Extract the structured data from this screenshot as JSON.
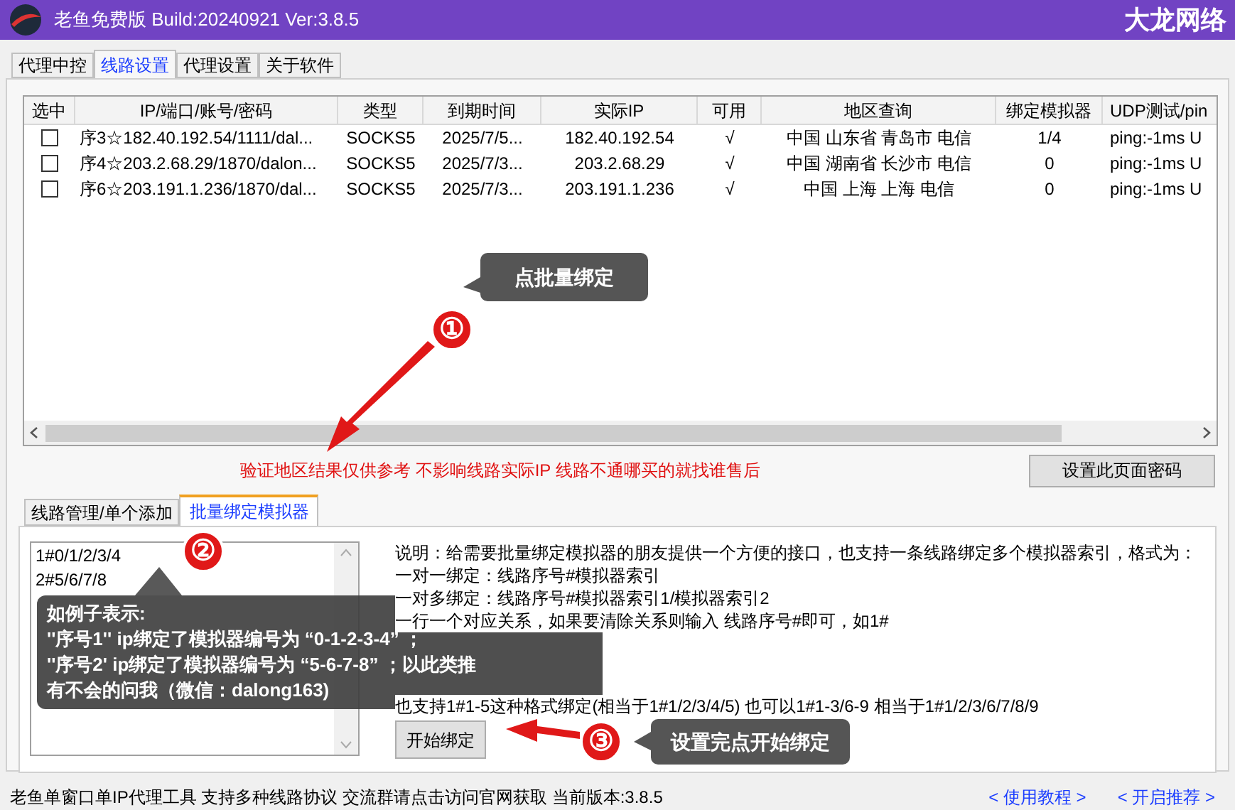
{
  "window": {
    "title": "老鱼免费版 Build:20240921 Ver:3.8.5",
    "brand": "大龙网络"
  },
  "tabs": [
    {
      "label": "代理中控",
      "selected": false
    },
    {
      "label": "线路设置",
      "selected": true
    },
    {
      "label": "代理设置",
      "selected": false
    },
    {
      "label": "关于软件",
      "selected": false
    }
  ],
  "table": {
    "check_column": "选中",
    "columns": [
      "IP/端口/账号/密码",
      "类型",
      "到期时间",
      "实际IP",
      "可用",
      "地区查询",
      "绑定模拟器",
      "UDP测试/pin"
    ],
    "rows": [
      {
        "checked": false,
        "cells": [
          "序3☆182.40.192.54/1111/dal...",
          "SOCKS5",
          "2025/7/5...",
          "182.40.192.54",
          "√",
          "中国 山东省 青岛市  电信",
          "1/4",
          "ping:-1ms  U"
        ]
      },
      {
        "checked": false,
        "cells": [
          "序4☆203.2.68.29/1870/dalon...",
          "SOCKS5",
          "2025/7/3...",
          "203.2.68.29",
          "√",
          "中国 湖南省 长沙市  电信",
          "0",
          "ping:-1ms  U"
        ]
      },
      {
        "checked": false,
        "cells": [
          "序6☆203.191.1.236/1870/dal...",
          "SOCKS5",
          "2025/7/3...",
          "203.191.1.236",
          "√",
          "中国 上海 上海  电信",
          "0",
          "ping:-1ms  U"
        ]
      }
    ]
  },
  "notice": "验证地区结果仅供参考 不影响线路实际IP 线路不通哪买的就找谁售后",
  "password_button": "设置此页面密码",
  "sub_tabs": [
    {
      "label": "线路管理/单个添加",
      "selected": false
    },
    {
      "label": "批量绑定模拟器",
      "selected": true
    }
  ],
  "bind_input": {
    "value": "1#0/1/2/3/4\n2#5/6/7/8"
  },
  "instructions": [
    "说明：给需要批量绑定模拟器的朋友提供一个方便的接口，也支持一条线路绑定多个模拟器索引，格式为：",
    "一对一绑定：线路序号#模拟器索引",
    "一对多绑定：线路序号#模拟器索引1/模拟器索引2",
    "一行一个对应关系，如果要清除关系则输入 线路序号#即可，如1#",
    "也支持1#1-5这种格式绑定(相当于1#1/2/3/4/5) 也可以1#1-3/6-9 相当于1#1/2/3/6/7/8/9"
  ],
  "start_button": "开始绑定",
  "status_bar": {
    "text": "老鱼单窗口单IP代理工具 支持多种线路协议 交流群请点击访问官网获取  当前版本:3.8.5",
    "links": [
      "< 使用教程 >",
      "< 开启推荐 >"
    ]
  },
  "annotations": [
    {
      "kind": "callout",
      "text": "点批量绑定"
    },
    {
      "kind": "step",
      "text": "①"
    },
    {
      "kind": "step",
      "text": "②"
    },
    {
      "kind": "tooltip",
      "lines": [
        "如例子表示:",
        "''序号1'' ip绑定了模拟器编号为 “0-1-2-3-4” ；",
        "''序号2' ip绑定了模拟器编号为 “5-6-7-8” ；以此类推",
        "有不会的问我（微信：dalong163)"
      ]
    },
    {
      "kind": "step",
      "text": "③"
    },
    {
      "kind": "callout",
      "text": "设置完点开始绑定"
    }
  ]
}
